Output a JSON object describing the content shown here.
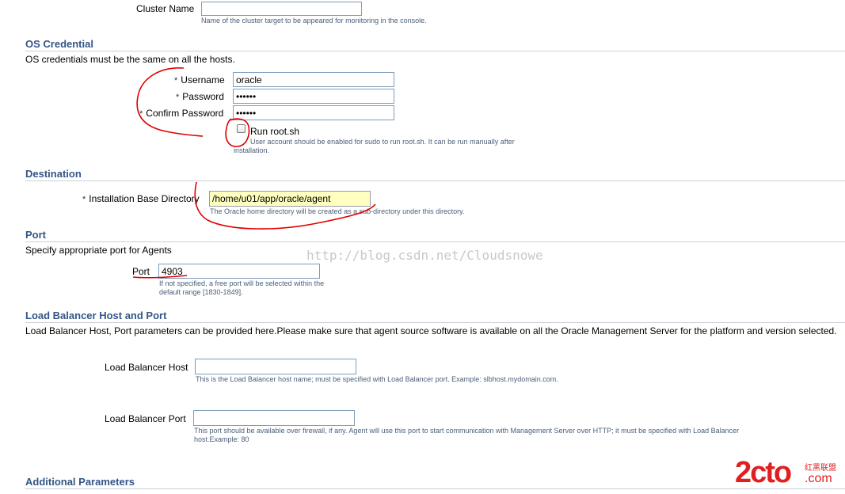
{
  "cluster": {
    "label": "Cluster Name",
    "value": "",
    "hint": "Name of the cluster target to be appeared for monitoring in the console."
  },
  "os_credential": {
    "title": "OS Credential",
    "description": "OS credentials must be the same on all the hosts.",
    "required_mark": "*",
    "username_label": "Username",
    "username_value": "oracle",
    "password_label": "Password",
    "password_value": "oracle",
    "confirm_label": "Confirm Password",
    "confirm_value": "oracle",
    "run_root_label": "Run root.sh",
    "run_root_checked": false,
    "run_root_hint": "User account should be enabled for sudo to run root.sh. It can be run manually after installation."
  },
  "destination": {
    "title": "Destination",
    "required_mark": "*",
    "install_dir_label": "Installation Base Directory",
    "install_dir_value": "/home/u01/app/oracle/agent",
    "install_dir_hint": "The Oracle home directory will be created as a sub-directory under this directory."
  },
  "port": {
    "title": "Port",
    "description": "Specify appropriate port for Agents",
    "port_label": "Port",
    "port_value": "4903",
    "port_hint": "If not specified, a free port will be selected within the default range [1830-1849]."
  },
  "load_balancer": {
    "title": "Load Balancer Host and Port",
    "description": "Load Balancer Host, Port parameters can be provided here.Please make sure that agent source software is available on all the Oracle Management Server for the platform and version selected.",
    "host_label": "Load Balancer Host",
    "host_value": "",
    "host_hint": "This is the Load Balancer host name; must be specified with Load Balancer port. Example: slbhost.mydomain.com.",
    "port_label": "Load Balancer Port",
    "port_value": "",
    "port_hint": "This port should be available over firewall, if any. Agent will use this port to start communication with Management Server over HTTP; it must be specified with Load Balancer host.Example: 80"
  },
  "additional": {
    "title": "Additional Parameters"
  },
  "watermark": {
    "url": "http://blog.csdn.net/Cloudsnowe",
    "logo_text": "2cto",
    "logo_suffix": ".com",
    "logo_cn": "红黑联盟"
  },
  "colors": {
    "section_title": "#335587",
    "annotation": "#e00000",
    "highlight_field": "#ffffc0"
  }
}
